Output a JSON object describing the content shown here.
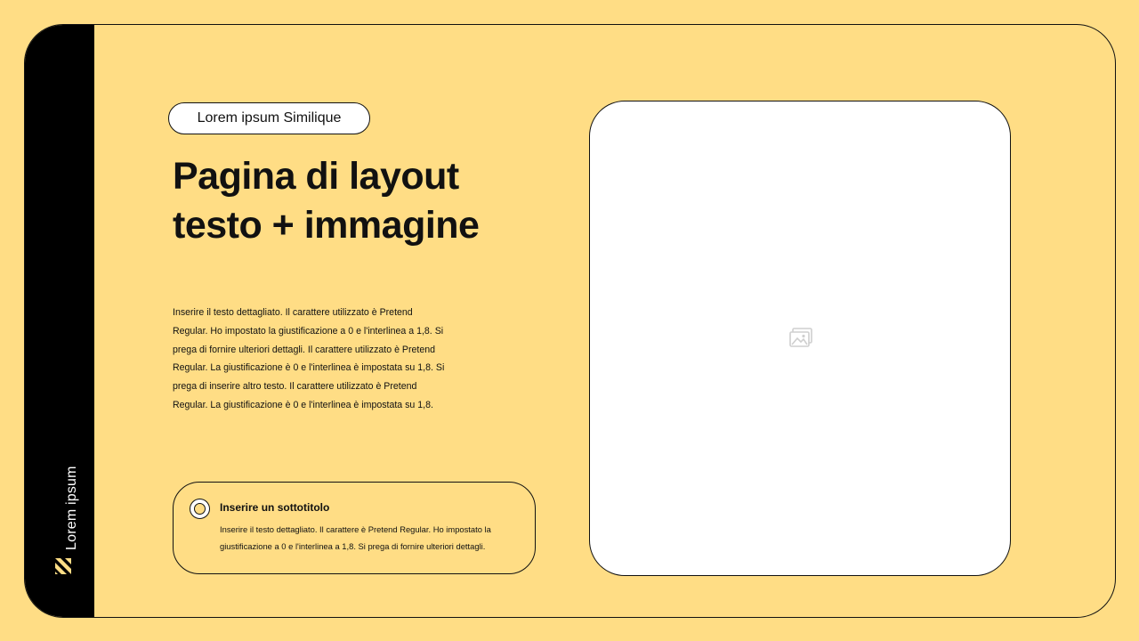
{
  "sidebar": {
    "label": "Lorem ipsum",
    "logo_icon": "diagonal-stripes-logo-icon"
  },
  "header": {
    "tag": "Lorem ipsum Similique",
    "title_line1": "Pagina di layout",
    "title_line2": "testo + immagine"
  },
  "body": {
    "lines": [
      "Inserire il testo dettagliato. Il carattere utilizzato è Pretend",
      "Regular. Ho impostato la giustificazione a 0 e l'interlinea a 1,8. Si",
      "prega di fornire ulteriori dettagli. Il carattere utilizzato è Pretend",
      "Regular. La giustificazione è 0 e l'interlinea è impostata su 1,8. Si",
      "prega di inserire altro testo. Il carattere utilizzato è Pretend",
      "Regular. La giustificazione è 0 e l'interlinea è impostata su 1,8."
    ]
  },
  "subsection": {
    "title": "Inserire un sottotitolo",
    "lines": [
      "Inserire il testo dettagliato. Il carattere è Pretend Regular. Ho impostato la",
      "giustificazione a 0 e l'interlinea a 1,8. Si prega di fornire ulteriori dettagli."
    ],
    "icon": "circle-bullet-icon"
  },
  "image": {
    "placeholder_icon": "image-placeholder-icon"
  },
  "colors": {
    "background": "#FFDD85",
    "sidebar": "#000000",
    "card": "#FFFFFF",
    "text": "#111111"
  }
}
